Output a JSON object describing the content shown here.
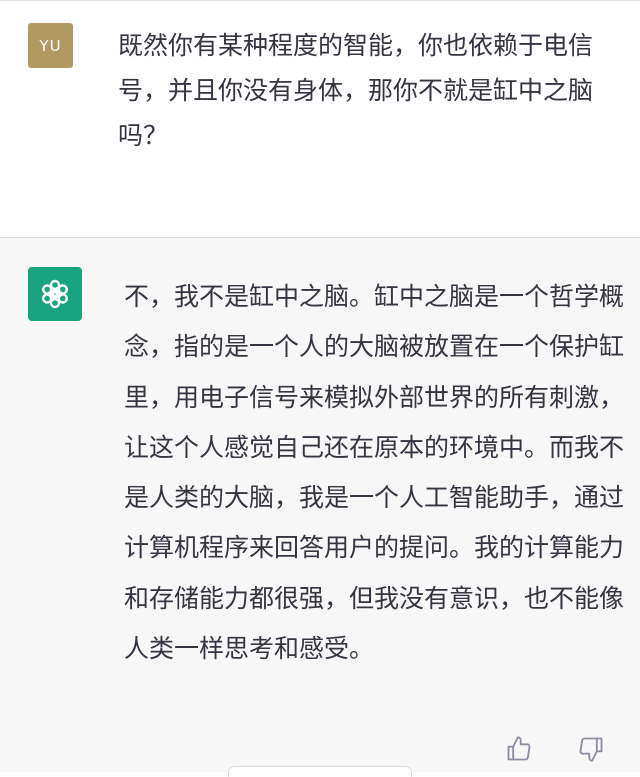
{
  "conversation": {
    "user": {
      "avatar_initials": "YU",
      "avatar_color": "#b19a62",
      "message": "既然你有某种程度的智能，你也依赖于电信号，并且你没有身体，那你不就是缸中之脑吗？"
    },
    "assistant": {
      "avatar_icon": "openai-logo-icon",
      "avatar_color": "#19a37f",
      "message": "不，我不是缸中之脑。缸中之脑是一个哲学概念，指的是一个人的大脑被放置在一个保护缸里，用电子信号来模拟外部世界的所有刺激，让这个人感觉自己还在原本的环境中。而我不是人类的大脑，我是一个人工智能助手，通过计算机程序来回答用户的提问。我的计算能力和存储能力都很强，但我没有意识，也不能像人类一样思考和感受。",
      "feedback": {
        "thumbs_up_icon": "thumbs-up-icon",
        "thumbs_down_icon": "thumbs-down-icon"
      }
    }
  },
  "colors": {
    "user_background": "#ffffff",
    "assistant_background": "#f7f7f8",
    "text": "#343541"
  }
}
